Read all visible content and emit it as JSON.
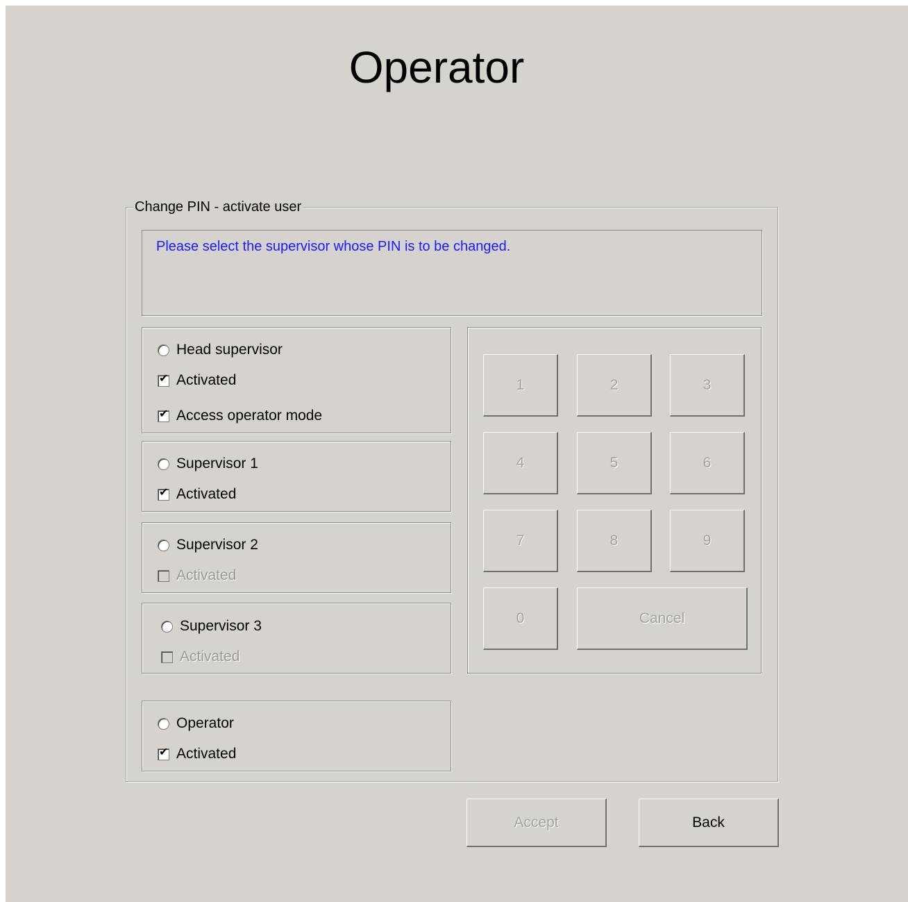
{
  "window": {
    "title": "Operator"
  },
  "group": {
    "legend": "Change PIN - activate user",
    "message": "Please select the supervisor whose PIN is to be changed."
  },
  "users": [
    {
      "name": "Head supervisor",
      "selected": false,
      "activated_label": "Activated",
      "activated": true,
      "activated_enabled": true,
      "access_label": "Access operator mode",
      "access": true
    },
    {
      "name": "Supervisor 1",
      "selected": false,
      "activated_label": "Activated",
      "activated": true,
      "activated_enabled": true
    },
    {
      "name": "Supervisor 2",
      "selected": false,
      "activated_label": "Activated",
      "activated": false,
      "activated_enabled": false
    },
    {
      "name": "Supervisor 3",
      "selected": false,
      "activated_label": "Activated",
      "activated": false,
      "activated_enabled": false
    },
    {
      "name": "Operator",
      "selected": false,
      "activated_label": "Activated",
      "activated": true,
      "activated_enabled": true
    }
  ],
  "keypad": {
    "keys": [
      "1",
      "2",
      "3",
      "4",
      "5",
      "6",
      "7",
      "8",
      "9",
      "0"
    ],
    "cancel_label": "Cancel",
    "enabled": false
  },
  "buttons": {
    "accept_label": "Accept",
    "accept_enabled": false,
    "back_label": "Back",
    "back_enabled": true
  },
  "colors": {
    "background": "#d6d3ce",
    "message_text": "#1a1aff",
    "disabled_text": "#a3a3a3"
  }
}
